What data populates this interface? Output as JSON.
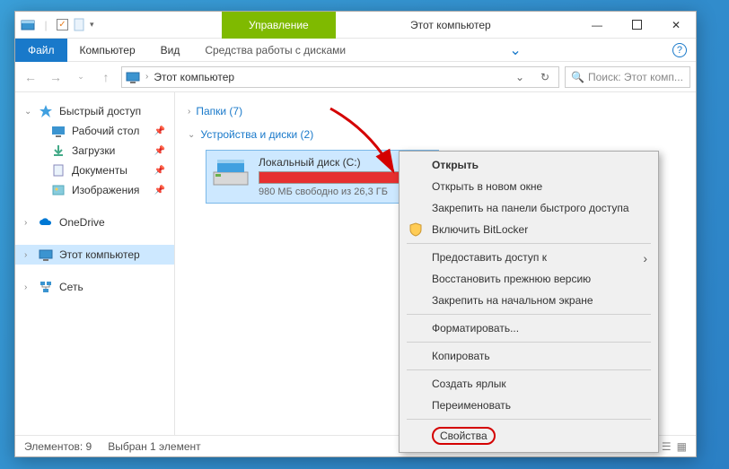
{
  "titlebar": {
    "manage_tab": "Управление",
    "title": "Этот компьютер"
  },
  "ribbon": {
    "file": "Файл",
    "computer": "Компьютер",
    "view": "Вид",
    "drive_tools": "Средства работы с дисками"
  },
  "nav": {
    "address": "Этот компьютер",
    "search_placeholder": "Поиск: Этот комп..."
  },
  "sidebar": {
    "quick": "Быстрый доступ",
    "desktop": "Рабочий стол",
    "downloads": "Загрузки",
    "documents": "Документы",
    "pictures": "Изображения",
    "onedrive": "OneDrive",
    "thispc": "Этот компьютер",
    "network": "Сеть"
  },
  "content": {
    "folders_head": "Папки (7)",
    "devices_head": "Устройства и диски (2)",
    "drive_name": "Локальный диск (C:)",
    "drive_free": "980 МБ свободно из 26,3 ГБ"
  },
  "status": {
    "count": "Элементов: 9",
    "selected": "Выбран 1 элемент"
  },
  "ctx": {
    "open": "Открыть",
    "open_new": "Открыть в новом окне",
    "pin_quick": "Закрепить на панели быстрого доступа",
    "bitlocker": "Включить BitLocker",
    "share": "Предоставить доступ к",
    "restore": "Восстановить прежнюю версию",
    "pin_start": "Закрепить на начальном экране",
    "format": "Форматировать...",
    "copy": "Копировать",
    "shortcut": "Создать ярлык",
    "rename": "Переименовать",
    "properties": "Свойства"
  }
}
